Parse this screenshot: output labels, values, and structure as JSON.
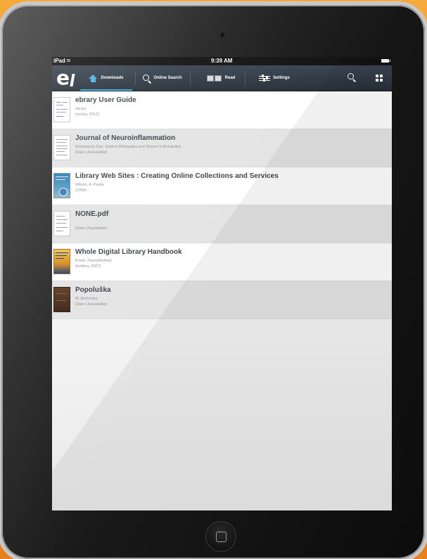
{
  "status_bar": {
    "carrier": "iPad",
    "time": "9:39 AM"
  },
  "toolbar": {
    "logo_text": "e",
    "tabs": [
      {
        "label": "Downloads",
        "icon": "home-icon",
        "active": true
      },
      {
        "label": "Online Search",
        "icon": "search-icon",
        "active": false
      },
      {
        "label": "Read",
        "icon": "book-icon",
        "active": false
      },
      {
        "label": "Settings",
        "icon": "sliders-icon",
        "active": false
      }
    ],
    "right_icons": [
      "search-icon",
      "grid-icon"
    ],
    "accent_color": "#37a6de"
  },
  "downloads": [
    {
      "title": "ebrary User Guide",
      "author": "ebrary",
      "date": "(ervina, 2012)",
      "cover": "document"
    },
    {
      "title": "Journal of Neuroinflammation",
      "author": "Mahaswetu Das, Subhra Mohapatra and Shyam S Mohapatra",
      "date": "(Date Unavailable)",
      "cover": "document"
    },
    {
      "title": "Library Web Sites : Creating Online Collections and Services",
      "author": "Wilson, A. Paula",
      "date": "(2004)",
      "cover": "blue"
    },
    {
      "title": "NONE.pdf",
      "author": "",
      "date": "(Date Unavailable)",
      "cover": "document"
    },
    {
      "title": "Whole Digital Library Handbook",
      "author": "Kresh, Diane(Author)",
      "date": "(květina, 2007)",
      "cover": "gold"
    },
    {
      "title": "Popoluška",
      "author": "M. Beňovský",
      "date": "(Date Unavailable)",
      "cover": "brown"
    }
  ]
}
